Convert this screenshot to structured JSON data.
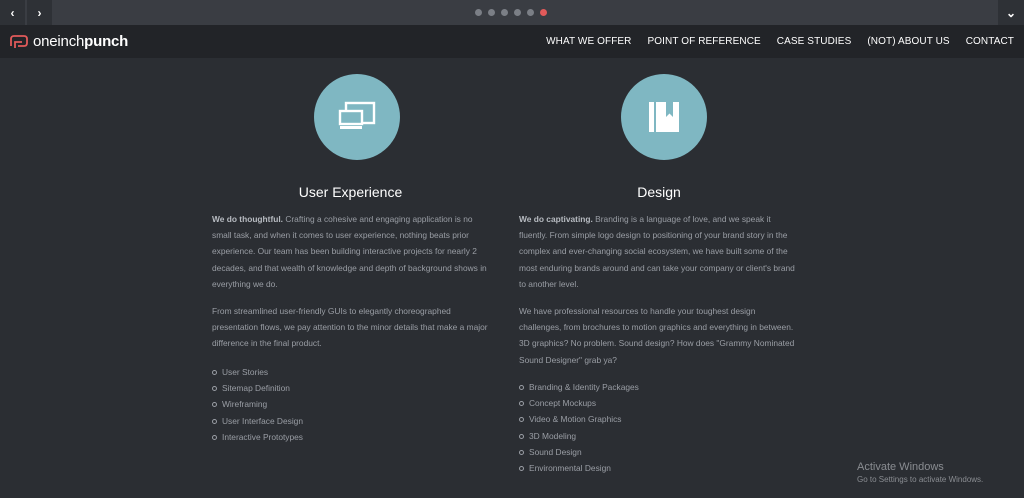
{
  "slider": {
    "prev_glyph": "‹",
    "next_glyph": "›",
    "dropdown_glyph": "⌄",
    "dots_count": 6,
    "active_dot": 5,
    "accent": "#e15a5a"
  },
  "brand": {
    "logo_light": "oneinch",
    "logo_bold": "punch",
    "logo_color": "#e15a5a"
  },
  "nav": {
    "items": [
      "WHAT WE OFFER",
      "POINT OF REFERENCE",
      "CASE STUDIES",
      "(NOT) ABOUT US",
      "CONTACT"
    ]
  },
  "ux": {
    "icon": "screens-icon",
    "title": "User Experience",
    "intro_bold": "We do thoughtful.",
    "intro_text": " Crafting a cohesive and engaging application is no small task, and when it comes to user experience, nothing beats prior experience. Our team has been building interactive projects for nearly 2 decades, and that wealth of knowledge and depth of background shows in everything we do.",
    "para2": "From streamlined user-friendly GUIs to elegantly choreographed presentation flows, we pay attention to the minor details that make a major difference in the final product.",
    "list": [
      "User Stories",
      "Sitemap Definition",
      "Wireframing",
      "User Interface Design",
      "Interactive Prototypes"
    ]
  },
  "design": {
    "icon": "book-icon",
    "title": "Design",
    "intro_bold": "We do captivating.",
    "intro_text": " Branding is a language of love, and we speak it fluently. From simple logo design to positioning of your brand story in the complex and ever-changing social ecosystem, we have built some of the most enduring brands around and can take your company or client's brand to another level.",
    "para2": "We have professional resources to handle your toughest design challenges, from brochures to motion graphics and everything in between. 3D graphics? No problem. Sound design? How does \"Grammy Nominated Sound Designer\" grab ya?",
    "list": [
      "Branding & Identity Packages",
      "Concept Mockups",
      "Video & Motion Graphics",
      "3D Modeling",
      "Sound Design",
      "Environmental Design"
    ]
  },
  "watermark": {
    "title": "Activate Windows",
    "subtitle": "Go to Settings to activate Windows."
  }
}
